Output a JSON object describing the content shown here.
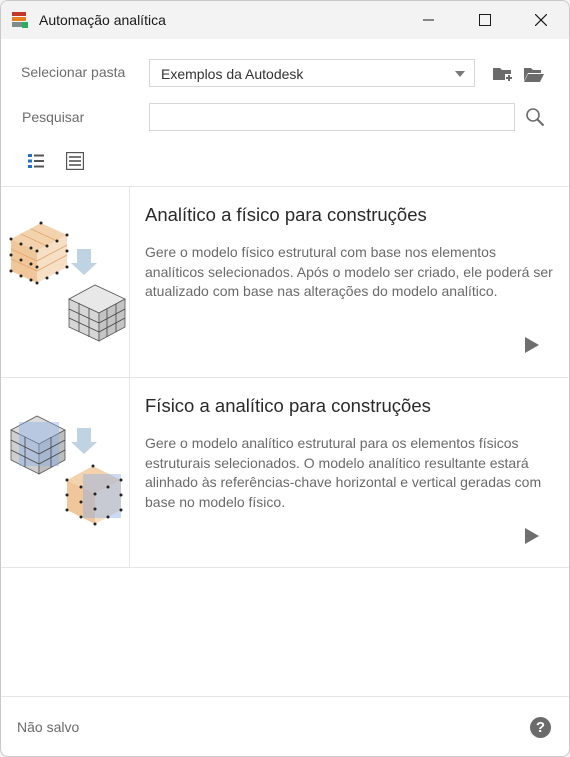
{
  "window": {
    "title": "Automação analítica",
    "controls": {
      "minimize_icon": "minimize-icon",
      "maximize_icon": "maximize-icon",
      "close_icon": "close-icon"
    }
  },
  "folder": {
    "label": "Selecionar pasta",
    "selected": "Exemplos da Autodesk",
    "new_folder_icon": "new-folder-icon",
    "open_folder_icon": "open-folder-icon"
  },
  "search": {
    "label": "Pesquisar",
    "value": "",
    "placeholder": "",
    "icon": "search-icon"
  },
  "view_modes": [
    "list-view-icon",
    "detail-view-icon"
  ],
  "items": [
    {
      "title": "Analítico a físico para construções",
      "description": "Gere o modelo físico estrutural com base nos elementos analíticos selecionados. Após o modelo ser criado, ele poderá ser atualizado com base nas alterações do modelo analítico.",
      "run_icon": "play-icon"
    },
    {
      "title": "Físico a analítico para construções",
      "description": "Gere o modelo analítico estrutural para os elementos físicos estruturais selecionados. O modelo analítico resultante estará alinhado às referências-chave horizontal e vertical geradas com base no modelo físico.",
      "run_icon": "play-icon"
    }
  ],
  "footer": {
    "status": "Não salvo",
    "help_icon": "help-icon"
  },
  "colors": {
    "accent": "#1e73c8",
    "titlebar": "#f3f3f3",
    "border": "#e6e6e6"
  }
}
